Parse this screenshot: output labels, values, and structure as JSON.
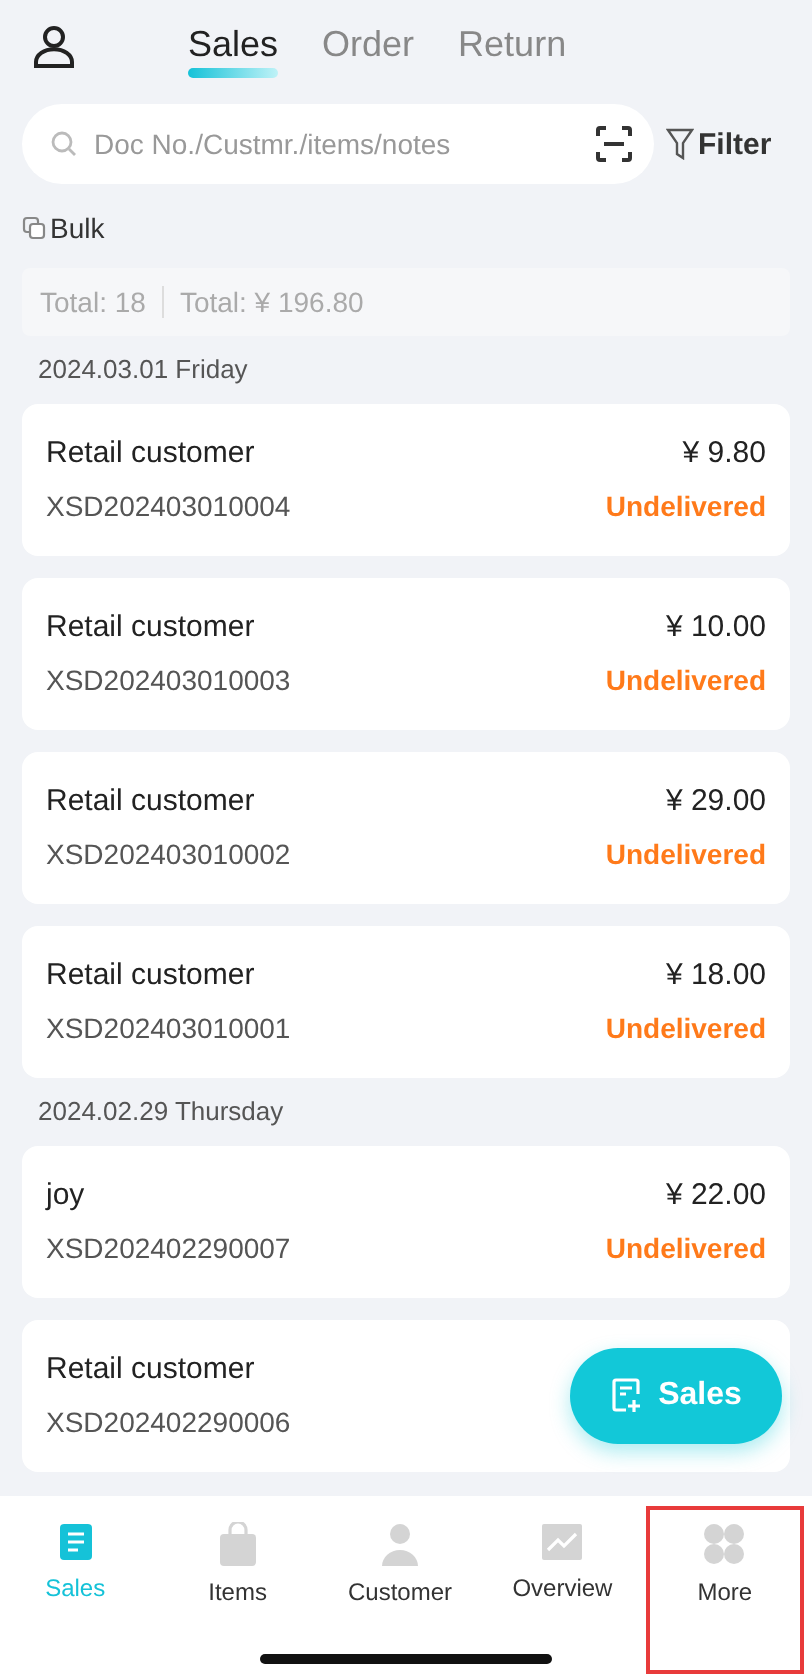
{
  "tabs": [
    {
      "label": "Sales",
      "selected": true
    },
    {
      "label": "Order",
      "selected": false
    },
    {
      "label": "Return",
      "selected": false
    }
  ],
  "search": {
    "placeholder": "Doc No./Custmr./items/notes"
  },
  "filter_label": "Filter",
  "bulk_label": "Bulk",
  "summary": {
    "count": "Total: 18",
    "amount": "Total: ¥ 196.80"
  },
  "groups": [
    {
      "date": "2024.03.01 Friday",
      "orders": [
        {
          "customer": "Retail customer",
          "doc_no": "XSD202403010004",
          "amount": "¥ 9.80",
          "status": "Undelivered"
        },
        {
          "customer": "Retail customer",
          "doc_no": "XSD202403010003",
          "amount": "¥ 10.00",
          "status": "Undelivered"
        },
        {
          "customer": "Retail customer",
          "doc_no": "XSD202403010002",
          "amount": "¥ 29.00",
          "status": "Undelivered"
        },
        {
          "customer": "Retail customer",
          "doc_no": "XSD202403010001",
          "amount": "¥ 18.00",
          "status": "Undelivered"
        }
      ]
    },
    {
      "date": "2024.02.29 Thursday",
      "orders": [
        {
          "customer": "joy",
          "doc_no": "XSD202402290007",
          "amount": "¥ 22.00",
          "status": "Undelivered"
        },
        {
          "customer": "Retail customer",
          "doc_no": "XSD202402290006"
        }
      ]
    }
  ],
  "fab_label": "Sales",
  "nav": [
    {
      "kind": "sales",
      "label": "Sales",
      "selected": true,
      "highlighted": false
    },
    {
      "kind": "items",
      "label": "Items",
      "selected": false,
      "highlighted": false
    },
    {
      "kind": "customer",
      "label": "Customer",
      "selected": false,
      "highlighted": false
    },
    {
      "kind": "overview",
      "label": "Overview",
      "selected": false,
      "highlighted": false
    },
    {
      "kind": "more",
      "label": "More",
      "selected": false,
      "highlighted": true
    }
  ]
}
